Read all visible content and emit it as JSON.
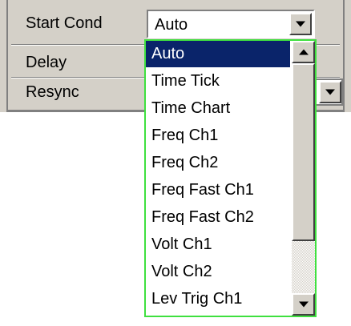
{
  "panel": {
    "rows": [
      {
        "label": "Start Cond"
      },
      {
        "label": "Delay"
      },
      {
        "label": "Resync"
      }
    ]
  },
  "combo": {
    "value": "Auto"
  },
  "dropdown": {
    "items": [
      "Auto",
      "Time Tick",
      "Time Chart",
      "Freq Ch1",
      "Freq Ch2",
      "Freq Fast Ch1",
      "Freq Fast Ch2",
      "Volt Ch1",
      "Volt Ch2",
      "Lev Trig Ch1"
    ],
    "selected_index": 0,
    "border_color": "#3fe03f",
    "selection_color": "#0a246a"
  },
  "icons": {
    "combo_button": "chevron-down-icon",
    "scroll_up": "chevron-up-icon",
    "scroll_down": "chevron-down-icon"
  }
}
